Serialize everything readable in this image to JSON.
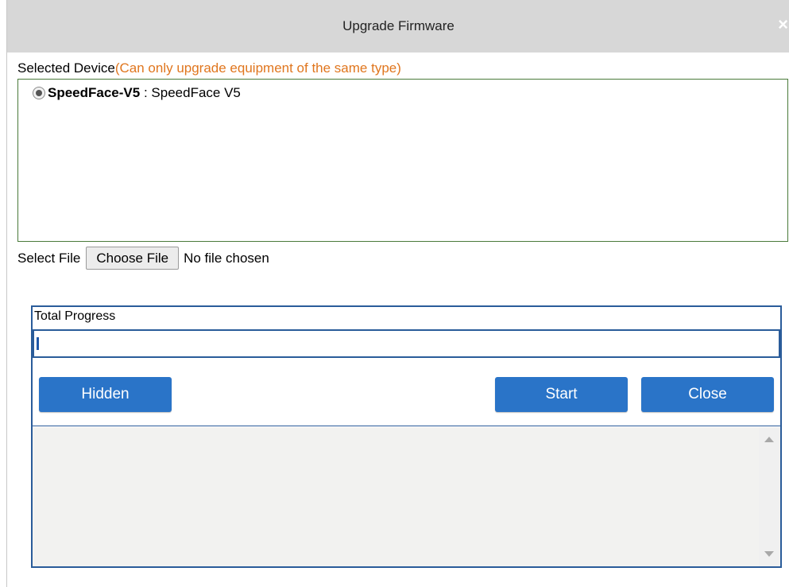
{
  "dialog": {
    "title": "Upgrade Firmware",
    "close_glyph": "×"
  },
  "selected_device": {
    "label": "Selected Device",
    "note": "(Can only upgrade equipment of the same type)",
    "devices": [
      {
        "name": "SpeedFace-V5",
        "separator": " : ",
        "description": "SpeedFace V5",
        "selected": true
      }
    ]
  },
  "file": {
    "label": "Select File",
    "button_label": "Choose File",
    "status": "No file chosen"
  },
  "progress": {
    "title": "Total Progress",
    "value": 0.0
  },
  "buttons": {
    "hidden": "Hidden",
    "start": "Start",
    "close": "Close"
  },
  "log": {
    "text": ""
  },
  "colors": {
    "note": "#e0761e",
    "button": "#2a74c8",
    "panel_border": "#2a5c9a",
    "device_box_border": "#4a7a3a"
  },
  "icons": [
    "close-icon",
    "radio-selected-icon",
    "scroll-up-icon",
    "scroll-down-icon"
  ]
}
